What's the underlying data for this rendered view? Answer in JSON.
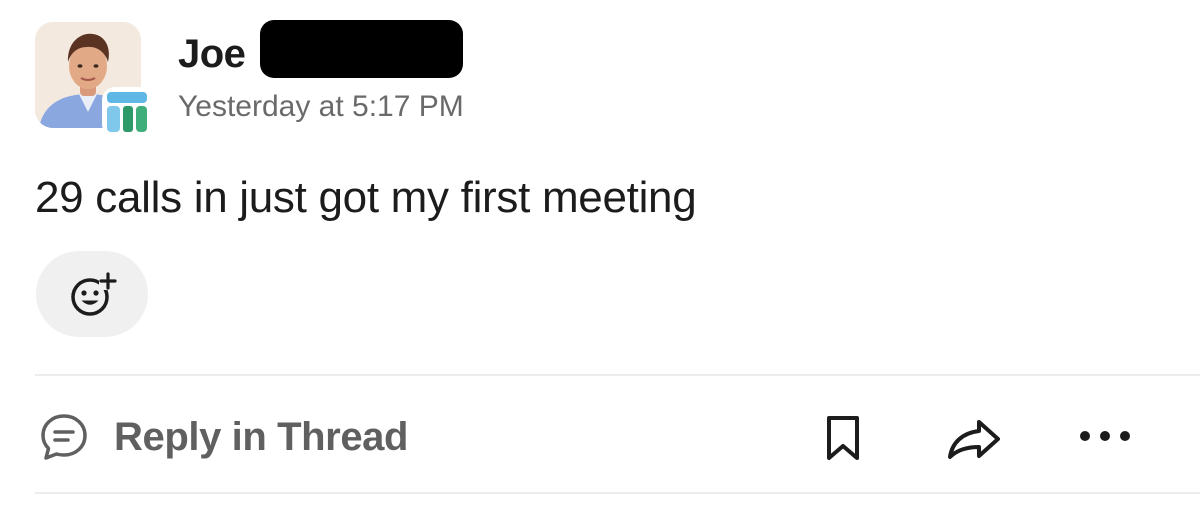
{
  "message": {
    "author": "Joe",
    "timestamp": "Yesterday at 5:17 PM",
    "text": "29 calls in just got my first meeting",
    "avatar": "user-avatar-photo",
    "app_badge": "app-badge-icon"
  },
  "reactions": {
    "add_reaction_icon": "add-reaction-icon"
  },
  "actions": {
    "reply_in_thread_label": "Reply in Thread",
    "reply_icon": "comment-icon",
    "bookmark_icon": "bookmark-icon",
    "share_icon": "share-icon",
    "more_icon": "more-icon"
  },
  "colors": {
    "text": "#1d1c1d",
    "muted": "#6b6a6b",
    "action_text": "#616061",
    "badge_blue": "#5fb7e5",
    "badge_green": "#2e9a6a",
    "reaction_bg": "#f0f0f0",
    "divider": "#ececec"
  }
}
